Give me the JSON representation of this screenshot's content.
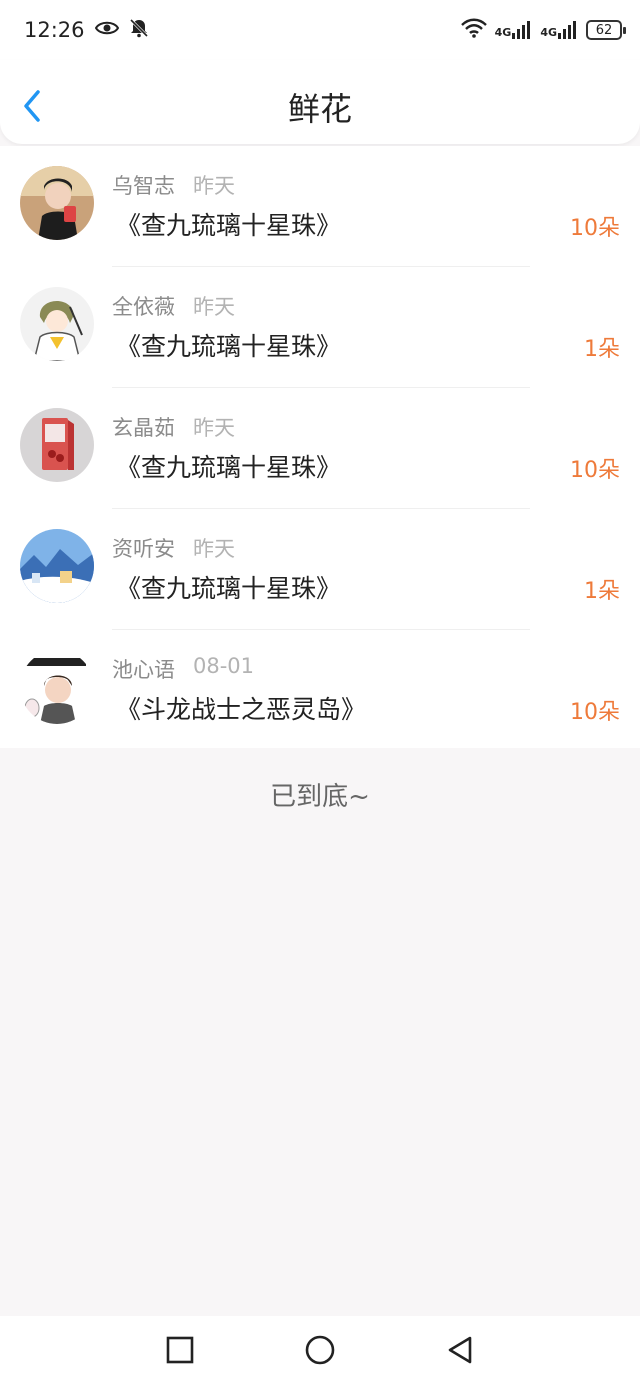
{
  "status": {
    "time": "12:26",
    "battery": "62",
    "network1": "4G",
    "network2": "4G"
  },
  "header": {
    "title": "鲜花"
  },
  "list": [
    {
      "name": "乌智志",
      "time": "昨天",
      "book": "《查九琉璃十星珠》",
      "count": "10朵",
      "avatar": "avatar-1"
    },
    {
      "name": "全依薇",
      "time": "昨天",
      "book": "《查九琉璃十星珠》",
      "count": "1朵",
      "avatar": "avatar-2"
    },
    {
      "name": "玄晶茹",
      "time": "昨天",
      "book": "《查九琉璃十星珠》",
      "count": "10朵",
      "avatar": "avatar-3"
    },
    {
      "name": "资听安",
      "time": "昨天",
      "book": "《查九琉璃十星珠》",
      "count": "1朵",
      "avatar": "avatar-4"
    },
    {
      "name": "池心语",
      "time": "08-01",
      "book": "《斗龙战士之恶灵岛》",
      "count": "10朵",
      "avatar": "avatar-5"
    }
  ],
  "footer": {
    "end_text": "已到底~"
  },
  "colors": {
    "accent": "#2196f3",
    "count": "#ee7a3a",
    "background": "#f8f6f7"
  },
  "icons": [
    "eye-icon",
    "bell-off-icon",
    "wifi-icon",
    "back-icon",
    "square-nav-icon",
    "circle-nav-icon",
    "triangle-back-nav-icon"
  ]
}
